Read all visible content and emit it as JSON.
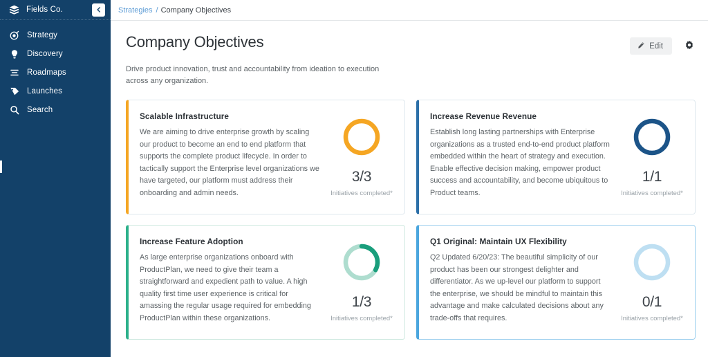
{
  "sidebar": {
    "brand": "Fields Co.",
    "logo_icon": "layers-icon",
    "collapse_icon": "chevron-left-icon",
    "items": [
      {
        "label": "Strategy",
        "icon": "target-icon"
      },
      {
        "label": "Discovery",
        "icon": "lightbulb-icon"
      },
      {
        "label": "Roadmaps",
        "icon": "list-lines-icon"
      },
      {
        "label": "Launches",
        "icon": "tag-icon"
      },
      {
        "label": "Search",
        "icon": "search-icon"
      }
    ],
    "background": "#134169"
  },
  "breadcrumb": {
    "parent": "Strategies",
    "separator": "/",
    "current": "Company Objectives",
    "link_color": "#5b9bd5"
  },
  "header": {
    "title": "Company Objectives",
    "description": "Drive product innovation, trust and accountability from ideation to execution across any organization.",
    "edit_label": "Edit",
    "edit_icon": "pencil-icon",
    "settings_icon": "gear-icon"
  },
  "cards": [
    {
      "title": "Scalable Infrastructure",
      "description": "We are aiming to drive enterprise growth by scaling our product to become an end to end platform that supports the complete product lifecycle. In order to tactically support the Enterprise level organizations we have targeted, our platform must address their onboarding and admin needs.",
      "metric_value": "3/3",
      "metric_label": "Initiatives completed*",
      "completed": 3,
      "total": 3,
      "percent": 100,
      "accent": "#F5A623",
      "ring_track": "#F5A623",
      "ring_fill": "#F5A623"
    },
    {
      "title": "Increase Revenue Revenue",
      "description": "Establish long lasting partnerships with Enterprise organizations as a trusted end-to-end product platform embedded within the heart of strategy and execution. Enable effective decision making, empower product success and accountability, and become ubiquitous to Product teams.",
      "metric_value": "1/1",
      "metric_label": "Initiatives completed*",
      "completed": 1,
      "total": 1,
      "percent": 100,
      "accent": "#2C6FA8",
      "ring_track": "#1C5488",
      "ring_fill": "#1C5488"
    },
    {
      "title": "Increase Feature Adoption",
      "description": "As large enterprise organizations onboard with ProductPlan, we need to give their team a straightforward and expedient path to value. A high quality first time user experience is critical for amassing the regular usage required for embedding ProductPlan within these organizations.",
      "metric_value": "1/3",
      "metric_label": "Initiatives completed*",
      "completed": 1,
      "total": 3,
      "percent": 33,
      "accent": "#2BB08A",
      "ring_track": "#AEDDCF",
      "ring_fill": "#1A9E7C"
    },
    {
      "title": "Q1 Original: Maintain UX Flexibility",
      "description": "Q2 Updated 6/20/23: The beautiful simplicity of our product has been our strongest delighter and differentiator. As we up-level our platform to support the enterprise, we should be mindful to maintain this advantage and make calculated decisions about any trade-offs that requires.",
      "metric_value": "0/1",
      "metric_label": "Initiatives completed*",
      "completed": 0,
      "total": 1,
      "percent": 0,
      "accent": "#4BA6DE",
      "ring_track": "#BEDFF2",
      "ring_fill": "#BEDFF2"
    }
  ]
}
